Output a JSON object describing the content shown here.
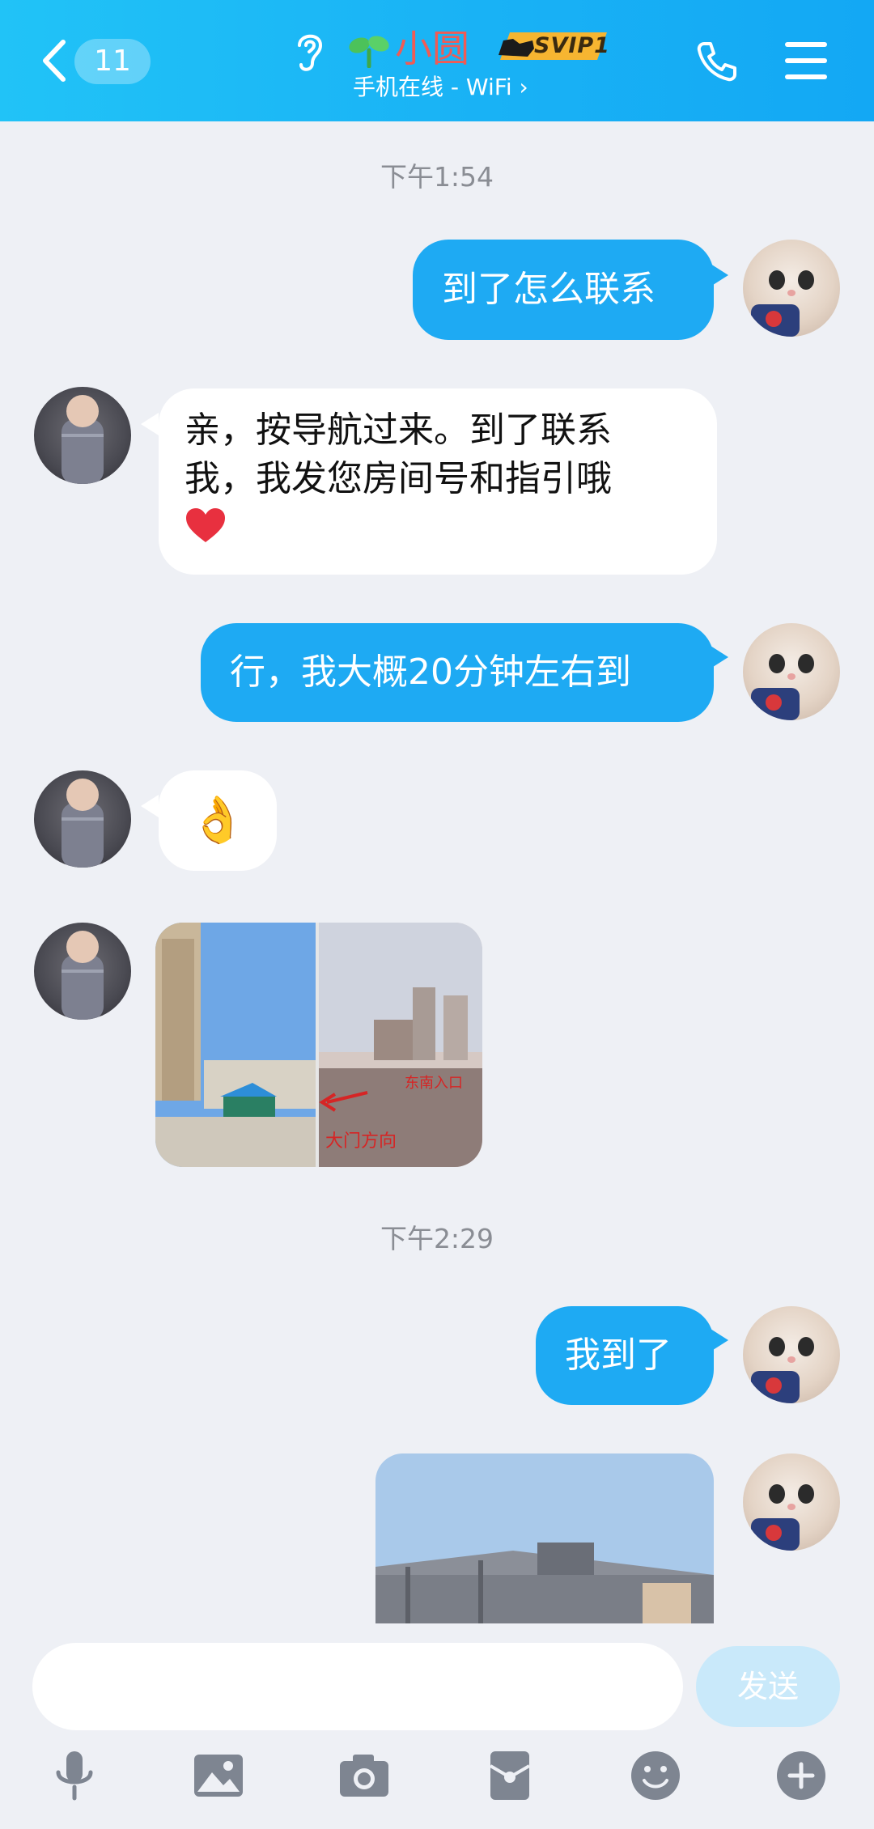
{
  "header": {
    "back_count": "11",
    "contact_name": "小圆",
    "vip_label": "SVIP1",
    "status": "手机在线 - WiFi",
    "status_chevron": "›"
  },
  "colors": {
    "header_start": "#21c3f7",
    "header_end": "#13a8f4",
    "outgoing_bubble": "#1eaaf3",
    "incoming_bubble": "#ffffff",
    "name_red": "#f05b55",
    "background": "#eef0f5",
    "send_button_disabled": "#c9e9fa"
  },
  "messages": {
    "time_1": "下午1:54",
    "msg_1": "到了怎么联系",
    "msg_2_line1": "亲，按导航过来。到了联系",
    "msg_2_line2": "我，我发您房间号和指引哦",
    "msg_3": "行，我大概20分钟左右到",
    "msg_4_emoji": "👌",
    "image_1_label_a": "东南入口",
    "image_1_label_b": "大门方向",
    "time_2": "下午2:29",
    "msg_5": "我到了"
  },
  "input": {
    "send_label": "发送"
  },
  "toolbar": [
    "mic-icon",
    "image-icon",
    "camera-icon",
    "red-packet-icon",
    "emoji-icon",
    "plus-icon"
  ]
}
